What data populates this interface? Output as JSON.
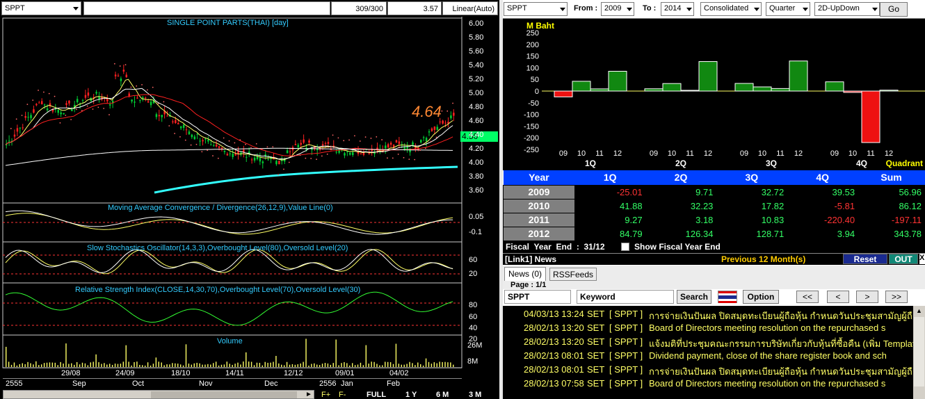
{
  "left": {
    "symbol": "SPPT",
    "field_ratio": "309/300",
    "field_last": "3.57",
    "scale_mode": "Linear(Auto)",
    "price_title": "SINGLE POINT PARTS(THAI) [day]",
    "last_price_big": "4.64",
    "last_price_tag": "4.50",
    "price_axis": [
      "6.00",
      "5.80",
      "5.60",
      "5.40",
      "5.20",
      "5.00",
      "4.80",
      "4.60",
      "4.40",
      "4.20",
      "4.00",
      "3.80",
      "3.60"
    ],
    "macd_title": "Moving Average Convergence / Divergence(26,12,9),Value Line(0)",
    "macd_axis": [
      "0.05",
      "-0.1"
    ],
    "stoch_title": "Slow Stochastics Oscillator(14,3,3),Overbought Level(80),Oversold Level(20)",
    "stoch_axis": [
      "60",
      "20"
    ],
    "rsi_title": "Relative Strength Index(CLOSE,14,30,70),Overbought Level(70),Oversold Level(30)",
    "rsi_axis": [
      "80",
      "60",
      "40",
      "20"
    ],
    "volume_title": "Volume",
    "volume_axis": [
      "26M",
      "8M"
    ],
    "date_labels": [
      "29/08",
      "24/09",
      "18/10",
      "14/11",
      "12/12",
      "09/01",
      "04/02"
    ],
    "month_labels": [
      "2555",
      "Sep",
      "Oct",
      "Nov",
      "Dec",
      "2556",
      "Jan",
      "Feb"
    ],
    "bottom_buttons": [
      "FULL",
      "1 Y",
      "6 M",
      "3 M"
    ],
    "colors": {
      "up": "#00cc33",
      "down": "#ff2020",
      "ma1": "#ffffff",
      "ma2": "#ffff66",
      "ma3": "#ff2020",
      "trend": "#33ffff",
      "sar": "#ff6666",
      "title": "#33ccff"
    }
  },
  "right": {
    "toolbar": {
      "symbol": "SPPT",
      "from_label": "From :",
      "from_value": "2009",
      "to_label": "To :",
      "to_value": "2014",
      "consolidation": "Consolidated",
      "period": "Quarter",
      "view": "2D-UpDown",
      "go_label": "Go"
    },
    "chart_data": {
      "type": "bar",
      "title": "M Baht",
      "xlabel": "Quadrant",
      "ylim": [
        -250,
        250
      ],
      "yticks": [
        "250",
        "200",
        "150",
        "100",
        "50",
        "0",
        "-50",
        "-100",
        "-150",
        "-200",
        "-250"
      ],
      "groups": [
        "1Q",
        "2Q",
        "3Q",
        "4Q"
      ],
      "categories": [
        "09",
        "10",
        "11",
        "12"
      ],
      "series": [
        {
          "name": "1Q",
          "values": [
            -25.01,
            41.88,
            9.27,
            84.79
          ]
        },
        {
          "name": "2Q",
          "values": [
            9.71,
            32.23,
            3.18,
            126.34
          ]
        },
        {
          "name": "3Q",
          "values": [
            32.72,
            17.82,
            10.83,
            128.71
          ]
        },
        {
          "name": "4Q",
          "values": [
            39.53,
            -5.81,
            -220.4,
            3.94
          ]
        }
      ],
      "colors": {
        "positive": "#118811",
        "negative": "#ee1111"
      }
    },
    "table": {
      "headers": [
        "Year",
        "1Q",
        "2Q",
        "3Q",
        "4Q",
        "Sum"
      ],
      "rows": [
        {
          "year": "2009",
          "values": [
            "-25.01",
            "9.71",
            "32.72",
            "39.53",
            "56.96"
          ]
        },
        {
          "year": "2010",
          "values": [
            "41.88",
            "32.23",
            "17.82",
            "-5.81",
            "86.12"
          ]
        },
        {
          "year": "2011",
          "values": [
            "9.27",
            "3.18",
            "10.83",
            "-220.40",
            "-197.11"
          ]
        },
        {
          "year": "2012",
          "values": [
            "84.79",
            "126.34",
            "128.71",
            "3.94",
            "343.78"
          ]
        }
      ]
    },
    "fiscal": {
      "label": "Fiscal  Year  End  :  31/12",
      "checkbox_label": "Show Fiscal Year End"
    },
    "news_bar": {
      "title": "[Link1] News",
      "previous": "Previous 12 Month(s)",
      "reset": "Reset",
      "out": "OUT",
      "close": "X"
    },
    "news_tabs": [
      "News (0)",
      "RSSFeeds"
    ],
    "page_label": "Page : 1/1",
    "search": {
      "symbol": "SPPT",
      "keyword": "Keyword",
      "search_button": "Search",
      "option_button": "Option",
      "nav": [
        "<<",
        "<",
        ">",
        ">>"
      ]
    },
    "news": [
      {
        "date": "04/03/13 13:24",
        "market": "SET",
        "symbol": "[ SPPT ]",
        "headline": "การจ่ายเงินปันผล ปิดสมุดทะเบียนผู้ถือหุ้น กำหนดวันประชุมสามัญผู้ถือหุ้นประจ"
      },
      {
        "date": "28/02/13 13:20",
        "market": "SET",
        "symbol": "[ SPPT ]",
        "headline": "Board of Directors  meeting resolution on the repurchased s"
      },
      {
        "date": "28/02/13 13:20",
        "market": "SET",
        "symbol": "[ SPPT ]",
        "headline": "แจ้งมติที่ประชุมคณะกรรมการบริษัทเกี่ยวกับหุ้นที่ซื้อคืน (เพิ่ม Template)"
      },
      {
        "date": "28/02/13 08:01",
        "market": "SET",
        "symbol": "[ SPPT ]",
        "headline": "Dividend payment, close of the share register book and sch"
      },
      {
        "date": "28/02/13 08:01",
        "market": "SET",
        "symbol": "[ SPPT ]",
        "headline": "การจ่ายเงินปันผล ปิดสมุดทะเบียนผู้ถือหุ้น กำหนดวันประชุมสามัญผู้ถือหุ้นประจ"
      },
      {
        "date": "28/02/13 07:58",
        "market": "SET",
        "symbol": "[ SPPT ]",
        "headline": "Board of Directors  meeting resolution on the repurchased s"
      }
    ]
  }
}
